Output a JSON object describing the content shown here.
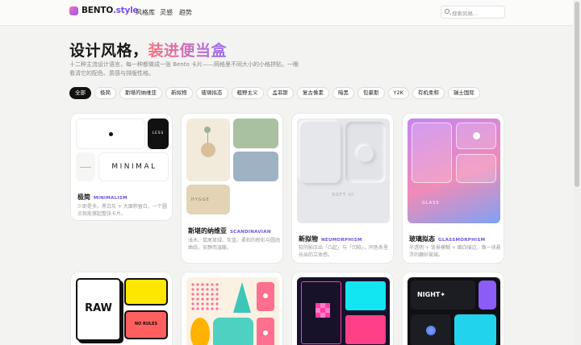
{
  "header": {
    "brand_main": "BENTO",
    "brand_suffix": ".style",
    "nav": [
      "风格库",
      "灵感",
      "趋势"
    ],
    "search_placeholder": "搜索风格…"
  },
  "hero": {
    "title_plain": "设计风格，",
    "title_highlight": "装进便当盒",
    "subtitle": "十二种主流设计语言，每一种都做成一张 Bento 卡片——网格里不同大小的小格拼贴，一眼看清它的配色、质感与排版性格。"
  },
  "filters": [
    "全部",
    "极简",
    "斯堪的纳维亚",
    "新拟物",
    "玻璃拟态",
    "粗野主义",
    "孟菲斯",
    "复古像素",
    "暗黑",
    "包豪斯",
    "Y2K",
    "有机柔和",
    "瑞士国际"
  ],
  "cards": [
    {
      "title": "极简",
      "en": "MINIMALISM",
      "desc": "少即是多。黑白灰 + 大面积留白，一个圆点就能撑起整张卡片。",
      "labels": [
        "LESS",
        "MINIMAL"
      ]
    },
    {
      "title": "斯堪的纳维亚",
      "en": "SCANDINAVIAN",
      "desc": "浅木、鼠尾草绿、灰蓝。柔和的粉彩与圆润曲线，安静而温暖。",
      "labels": [
        "HYGGE"
      ]
    },
    {
      "title": "新拟物",
      "en": "NEUMORPHISM",
      "desc": "软阴影压出「凸起」与「凹陷」，同色系里长出的立体感。",
      "labels": [
        "SOFT UI"
      ]
    },
    {
      "title": "玻璃拟态",
      "en": "GLASSMORPHISM",
      "desc": "半透明 + 背景模糊 + 细白描边，像一块悬浮的磨砂玻璃。",
      "labels": [
        "GLASS"
      ]
    },
    {
      "labels": [
        "RAW",
        "NO RULES"
      ]
    },
    {
      "labels": []
    },
    {
      "labels": []
    },
    {
      "labels": [
        "NIGHT✦"
      ]
    }
  ],
  "colors": {
    "accent": "#7b4fe6",
    "pink": "#ff6f7f"
  }
}
